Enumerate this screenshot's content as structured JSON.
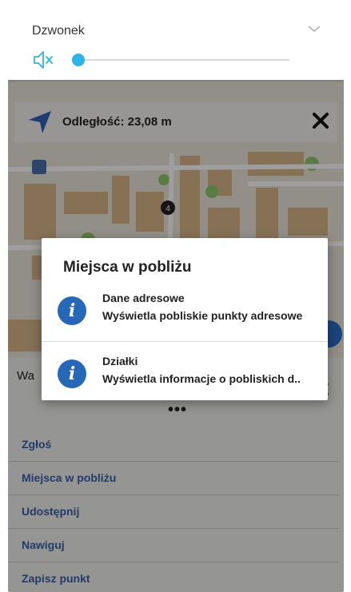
{
  "volume": {
    "label": "Dzwonek",
    "level": 0.0,
    "mute_icon": "volume-mute-icon",
    "expand_icon": "chevron-down-icon"
  },
  "distance_bar": {
    "text": "Odległość: 23,08 m",
    "arrow_icon": "navigation-arrow-icon",
    "close_icon": "close-icon"
  },
  "map": {
    "marker_label": "4"
  },
  "sheet": {
    "peek_text": "Wa",
    "more": "•••",
    "menu": [
      "Zgłoś",
      "Miejsca w pobliżu",
      "Udostępnij",
      "Nawiguj",
      "Zapisz punkt"
    ]
  },
  "dialog": {
    "title": "Miejsca w pobliżu",
    "options": [
      {
        "title": "Dane adresowe",
        "subtitle": "Wyświetla pobliskie punkty adresowe",
        "icon": "info-icon"
      },
      {
        "title": "Działki",
        "subtitle": "Wyświetla informacje o pobliskich d..",
        "icon": "info-icon"
      }
    ]
  },
  "colors": {
    "accent": "#2fb4e6",
    "info_blue": "#2767b8",
    "menu_link": "#3a5fa6",
    "building": "#d9b98c",
    "tree": "#8fc96a"
  }
}
